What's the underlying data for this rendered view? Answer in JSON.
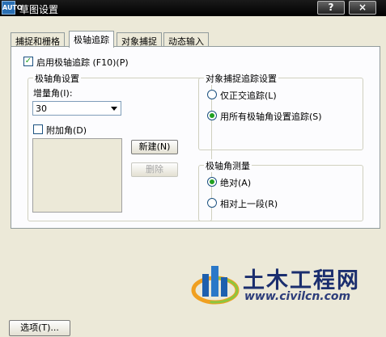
{
  "window": {
    "title": "草图设置",
    "help_label": "?",
    "close_label": "×",
    "app_icon_text": "AUTO"
  },
  "tabs": [
    {
      "label": "捕捉和栅格"
    },
    {
      "label": "极轴追踪"
    },
    {
      "label": "对象捕捉"
    },
    {
      "label": "动态输入"
    }
  ],
  "polar": {
    "enable_label": "启用极轴追踪 (F10)(P)",
    "enable_checked": true,
    "angle_group": {
      "title": "极轴角设置",
      "increment_label": "增量角(I):",
      "increment_value": "30",
      "additional_label": "附加角(D)",
      "additional_checked": false,
      "new_label": "新建(N)",
      "delete_label": "删除"
    },
    "snap_tracking_group": {
      "title": "对象捕捉追踪设置",
      "option_ortho": "仅正交追踪(L)",
      "option_all": "用所有极轴角设置追踪(S)",
      "selected": "all"
    },
    "measurement_group": {
      "title": "极轴角测量",
      "option_absolute": "绝对(A)",
      "option_relative": "相对上一段(R)",
      "selected": "absolute"
    }
  },
  "options_button": "选项(T)...",
  "watermark": {
    "name": "土木工程网",
    "url": "www.civilcn.com"
  }
}
